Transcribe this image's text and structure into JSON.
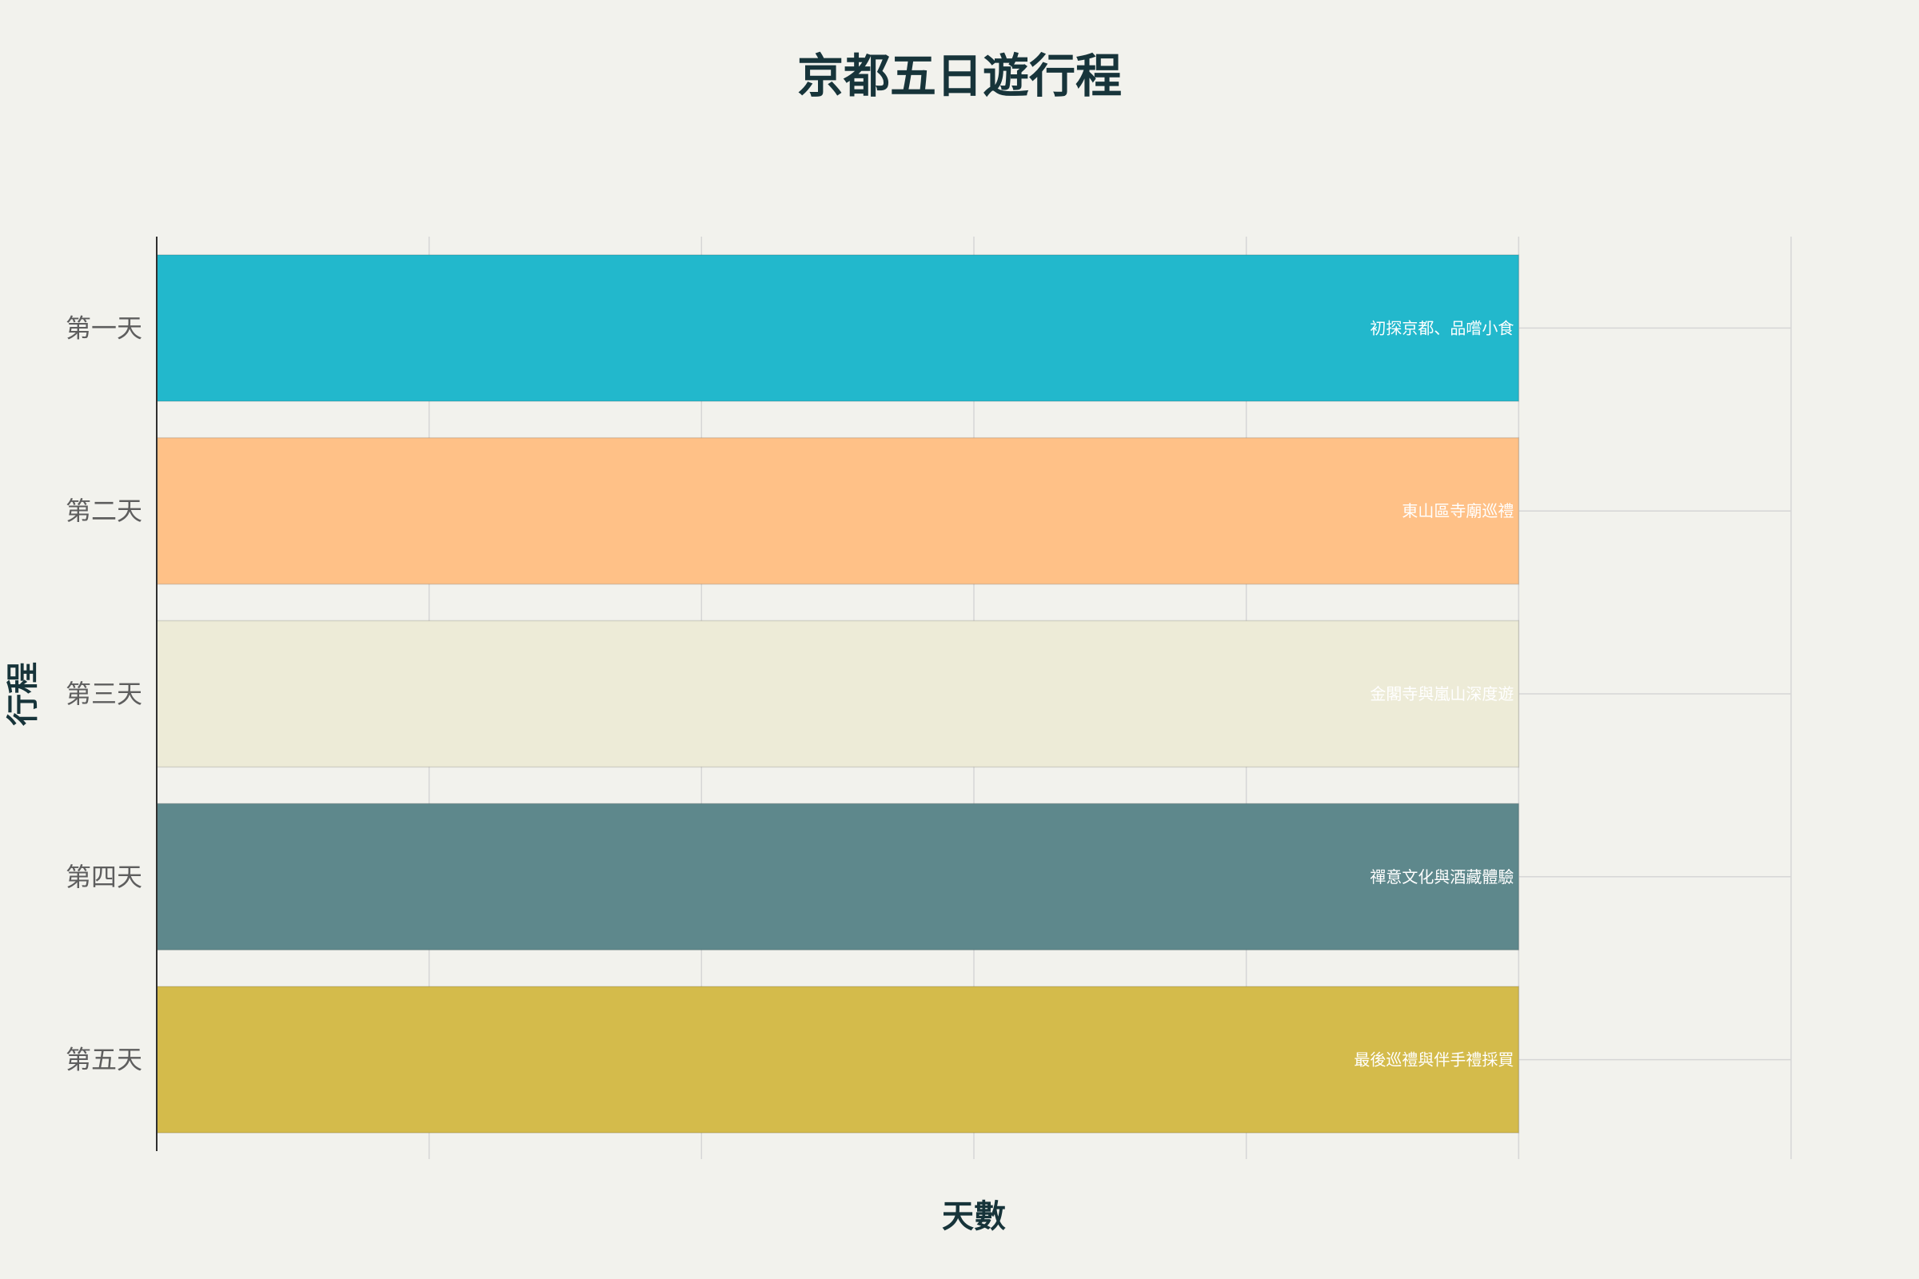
{
  "chart_data": {
    "type": "bar",
    "orientation": "horizontal",
    "title": "京都五日遊行程",
    "xlabel": "天數",
    "ylabel": "行程",
    "categories": [
      "第一天",
      "第二天",
      "第三天",
      "第四天",
      "第五天"
    ],
    "values": [
      1,
      1,
      1,
      1,
      1
    ],
    "bar_text": [
      "初探京都、品嚐小食",
      "東山區寺廟巡禮",
      "金閣寺與嵐山深度遊",
      "禪意文化與酒藏體驗",
      "最後巡禮與伴手禮採買"
    ],
    "colors": [
      "#22b8cc",
      "#ffc187",
      "#edebd7",
      "#5e888c",
      "#d4bb4b"
    ],
    "xlim": [
      0,
      1.2
    ],
    "grid": true,
    "legend": false
  }
}
